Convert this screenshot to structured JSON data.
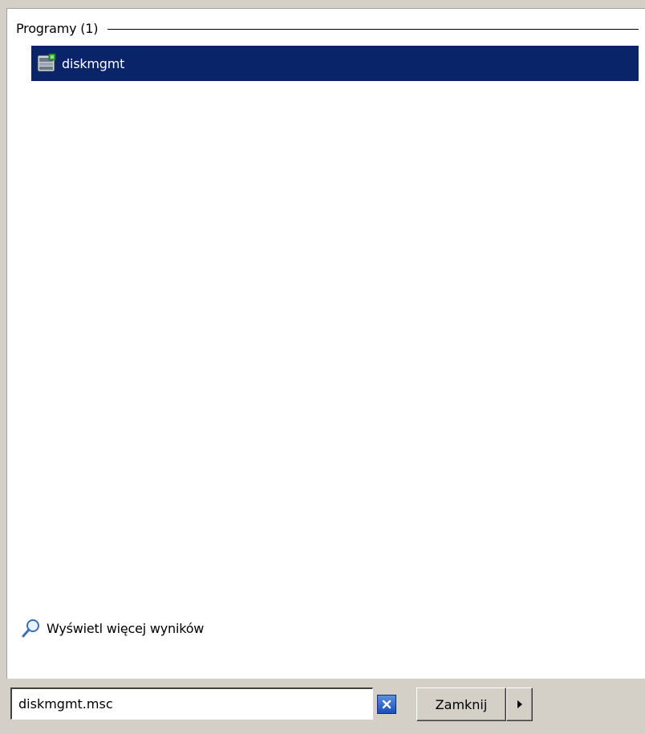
{
  "results": {
    "group_title": "Programy (1)",
    "items": [
      {
        "label": "diskmgmt",
        "icon": "disk-management-icon",
        "selected": true
      }
    ],
    "more_results_label": "Wyświetl więcej wyników",
    "more_results_icon": "magnifier-icon"
  },
  "search": {
    "value": "diskmgmt.msc",
    "clear_icon": "clear-search-icon"
  },
  "power": {
    "close_label": "Zamknij",
    "arrow_icon": "chevron-right-icon"
  },
  "colors": {
    "selection_bg": "#0a246a",
    "selection_text": "#ffffff",
    "panel_bg": "#d4d0c8",
    "pane_bg": "#ffffff"
  }
}
